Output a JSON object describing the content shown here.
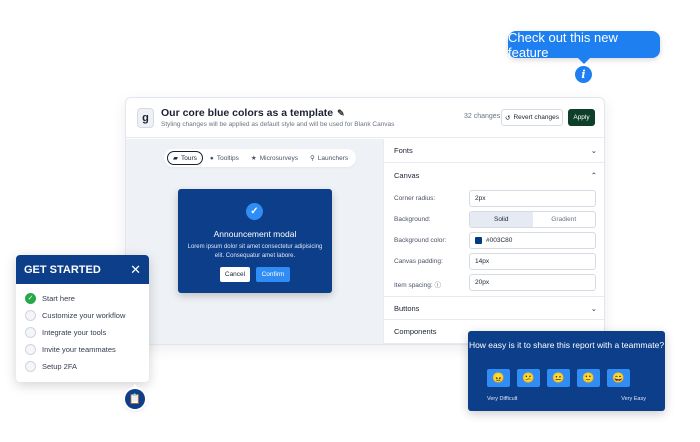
{
  "callout": {
    "text": "Check out this new feature",
    "info_icon": "info-icon"
  },
  "app": {
    "title": "Our core blue colors as a template",
    "subtitle": "Styling changes will be applied as default style and will be used for Blank Canvas",
    "changes": "32 changes",
    "revert_label": "Revert changes",
    "apply_label": "Apply",
    "tabs": [
      {
        "label": "Tours",
        "icon": "tour-icon"
      },
      {
        "label": "Tooltips",
        "icon": "tooltip-icon"
      },
      {
        "label": "Microsurveys",
        "icon": "star-icon"
      },
      {
        "label": "Launchers",
        "icon": "pin-icon"
      }
    ],
    "modal": {
      "title": "Announcement modal",
      "body": "Lorem ipsum dolor sit amet consectetur adipisicing elit. Consequatur amet labore.",
      "cancel": "Cancel",
      "confirm": "Confirm"
    },
    "panel": {
      "fonts": "Fonts",
      "canvas": "Canvas",
      "corner_radius_label": "Corner radius:",
      "corner_radius_value": "2px",
      "background_label": "Background:",
      "bg_solid": "Solid",
      "bg_gradient": "Gradient",
      "bg_color_label": "Background color:",
      "bg_color_value": "#003C80",
      "padding_label": "Canvas padding:",
      "padding_value": "14px",
      "spacing_label": "Item spacing:",
      "spacing_value": "20px",
      "buttons": "Buttons",
      "components": "Components"
    }
  },
  "get_started": {
    "title": "GET STARTED",
    "items": [
      {
        "label": "Start here",
        "done": true
      },
      {
        "label": "Customize your workflow",
        "done": false
      },
      {
        "label": "Integrate your tools",
        "done": false
      },
      {
        "label": "Invite your teammates",
        "done": false
      },
      {
        "label": "Setup 2FA",
        "done": false
      }
    ]
  },
  "survey": {
    "question": "How easy is it to share this report with a teammate?",
    "faces": [
      "😠",
      "😕",
      "😐",
      "🙂",
      "😄"
    ],
    "low_label": "Very Difficult",
    "high_label": "Very Easy"
  },
  "colors": {
    "brand_blue": "#0d3e8a",
    "accent": "#1d7ff0",
    "apply_green": "#0e3f2a"
  }
}
